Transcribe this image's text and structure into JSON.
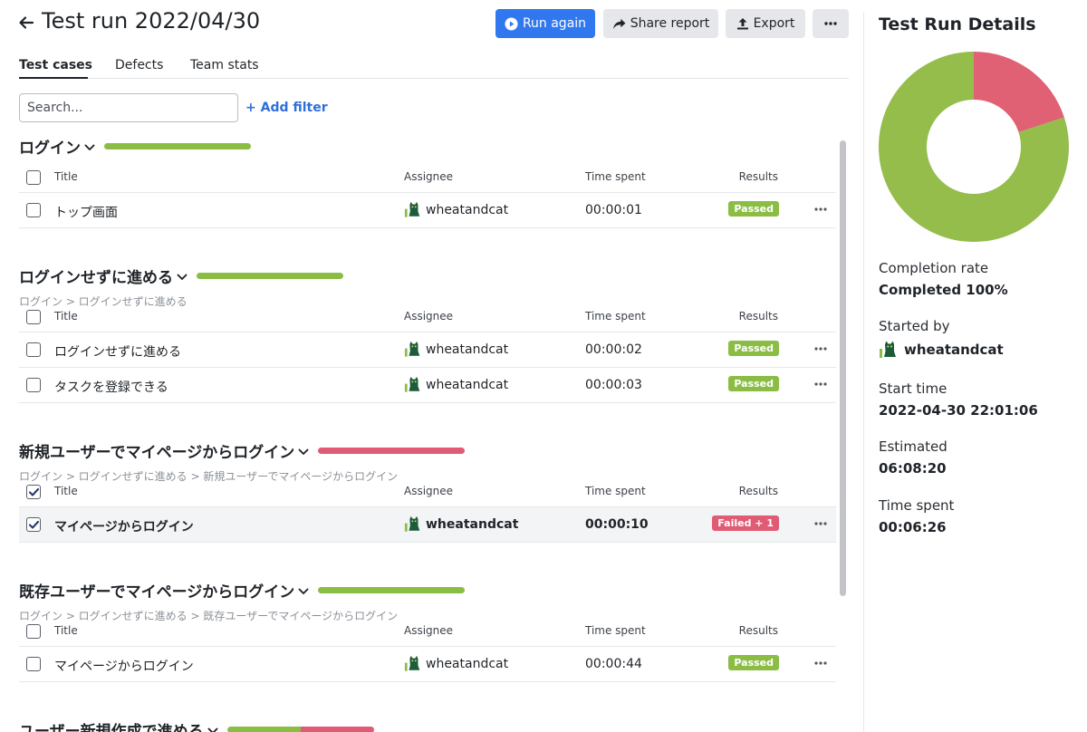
{
  "header": {
    "title": "Test run 2022/04/30",
    "buttons": {
      "run_again": "Run again",
      "share_report": "Share report",
      "export": "Export"
    }
  },
  "tabs": [
    {
      "label": "Test cases",
      "active": true
    },
    {
      "label": "Defects",
      "active": false
    },
    {
      "label": "Team stats",
      "active": false
    }
  ],
  "search": {
    "placeholder": "Search...",
    "value": ""
  },
  "add_filter": "+ Add filter",
  "columns": {
    "title": "Title",
    "assignee": "Assignee",
    "time_spent": "Time spent",
    "results": "Results"
  },
  "sections": [
    {
      "title": "ログイン",
      "breadcrumb": "",
      "progress": {
        "passed": 1.0,
        "failed": 0.0
      },
      "rows": [
        {
          "title": "トップ画面",
          "assignee": "wheatandcat",
          "time": "00:00:01",
          "result": "Passed",
          "checked": false
        }
      ]
    },
    {
      "title": "ログインせずに進める",
      "breadcrumb": "ログイン > ログインせずに進める",
      "progress": {
        "passed": 1.0,
        "failed": 0.0
      },
      "rows": [
        {
          "title": "ログインせずに進める",
          "assignee": "wheatandcat",
          "time": "00:00:02",
          "result": "Passed",
          "checked": false
        },
        {
          "title": "タスクを登録できる",
          "assignee": "wheatandcat",
          "time": "00:00:03",
          "result": "Passed",
          "checked": false
        }
      ]
    },
    {
      "title": "新規ユーザーでマイページからログイン",
      "breadcrumb": "ログイン > ログインせずに進める > 新規ユーザーでマイページからログイン",
      "progress": {
        "passed": 0.0,
        "failed": 1.0
      },
      "rows": [
        {
          "title": "マイページからログイン",
          "assignee": "wheatandcat",
          "time": "00:00:10",
          "result": "Failed + 1",
          "checked": true
        }
      ]
    },
    {
      "title": "既存ユーザーでマイページからログイン",
      "breadcrumb": "ログイン > ログインせずに進める > 既存ユーザーでマイページからログイン",
      "progress": {
        "passed": 1.0,
        "failed": 0.0
      },
      "rows": [
        {
          "title": "マイページからログイン",
          "assignee": "wheatandcat",
          "time": "00:00:44",
          "result": "Passed",
          "checked": false
        }
      ]
    },
    {
      "title": "ユーザー新規作成で進める",
      "breadcrumb": "",
      "progress": {
        "passed": 0.5,
        "failed": 0.5
      },
      "rows": []
    }
  ],
  "details": {
    "title": "Test Run Details",
    "chart": {
      "passed_fraction": 0.8,
      "failed_fraction": 0.2
    },
    "completion_rate_label": "Completion rate",
    "completion_rate_value": "Completed 100%",
    "started_by_label": "Started by",
    "started_by_value": "wheatandcat",
    "start_time_label": "Start time",
    "start_time_value": "2022-04-30 22:01:06",
    "estimated_label": "Estimated",
    "estimated_value": "06:08:20",
    "time_spent_label": "Time spent",
    "time_spent_value": "00:06:26"
  },
  "colors": {
    "primary": "#3178f0",
    "passed": "#8bbd45",
    "failed": "#e05b74",
    "chart_passed": "#94bd4c",
    "chart_failed": "#e06074"
  },
  "icons": [
    "back-arrow-icon",
    "play-icon",
    "share-icon",
    "export-icon",
    "more-icon",
    "chevron-down-icon",
    "avatar-icon",
    "check-icon"
  ]
}
